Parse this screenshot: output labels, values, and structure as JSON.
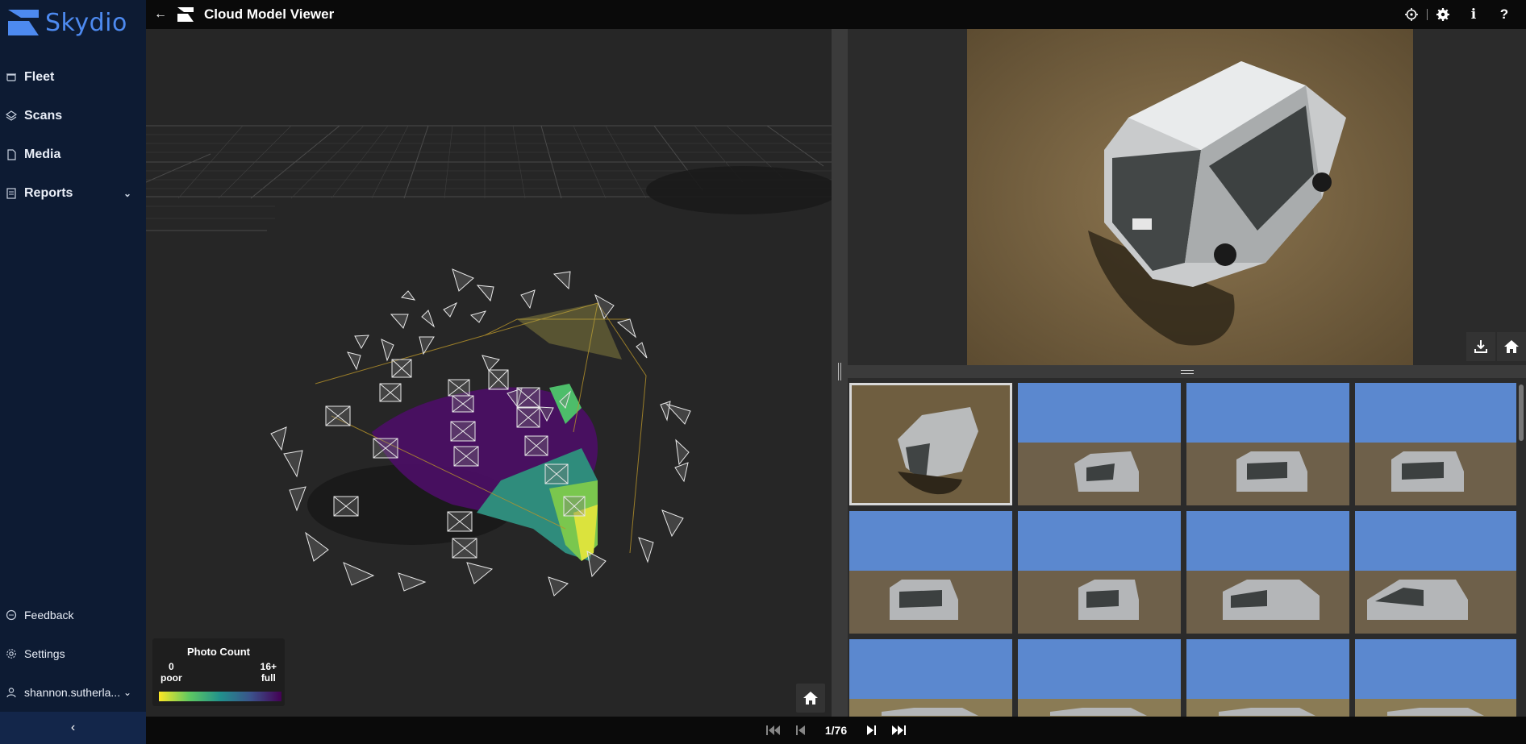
{
  "sidebar": {
    "brand": "Skydio",
    "items": [
      {
        "label": "Fleet",
        "icon": "drone-icon"
      },
      {
        "label": "Scans",
        "icon": "scan-icon"
      },
      {
        "label": "Media",
        "icon": "document-icon"
      },
      {
        "label": "Reports",
        "icon": "report-icon"
      }
    ],
    "bottom": [
      {
        "label": "Feedback",
        "icon": "chat-icon"
      },
      {
        "label": "Settings",
        "icon": "gear-icon"
      },
      {
        "label": "shannon.sutherla...",
        "icon": "user-icon"
      }
    ]
  },
  "header": {
    "title": "Cloud Model Viewer"
  },
  "legend": {
    "title": "Photo Count",
    "min_value": "0",
    "min_label": "poor",
    "max_value": "16+",
    "max_label": "full"
  },
  "pagination": {
    "current": "1/76"
  },
  "colors": {
    "sidebar_bg": "#0d1b33",
    "brand": "#4d8af0",
    "viewer_bg": "#262626"
  }
}
